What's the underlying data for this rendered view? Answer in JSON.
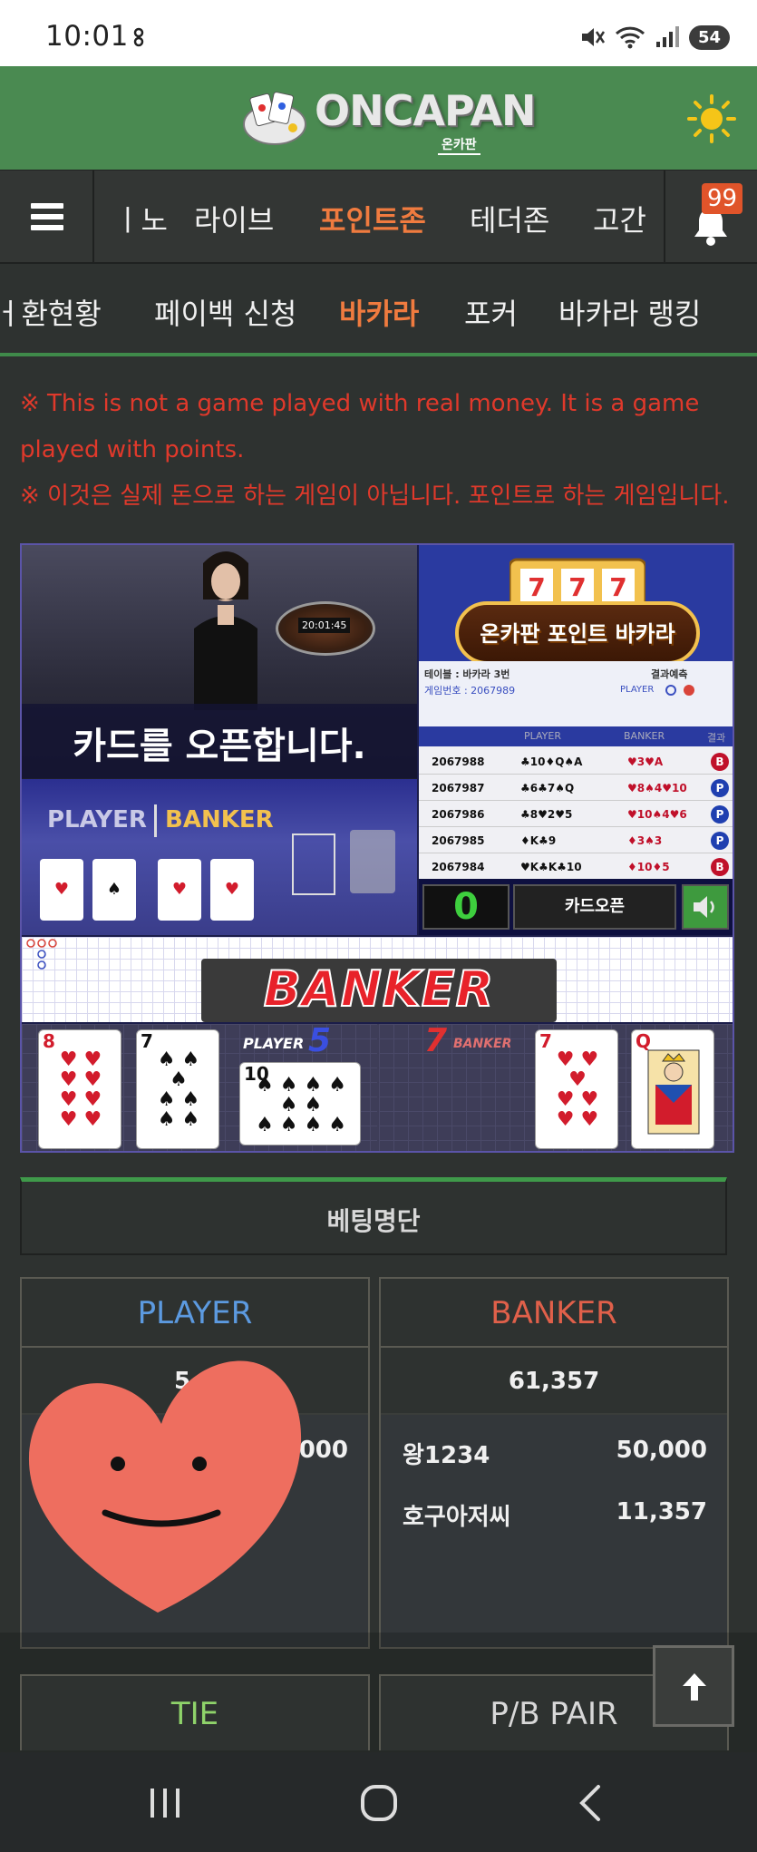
{
  "status_bar": {
    "time": "10:01",
    "battery": "54"
  },
  "header": {
    "logo_text": "ONCAPAN",
    "logo_sub": "온카판",
    "theme_icon": "sun-icon"
  },
  "main_nav": {
    "items": [
      "ㅣ노",
      "라이브",
      "포인트존",
      "테더존",
      "고간"
    ],
    "active": "포인트존",
    "notification_count": "99"
  },
  "sub_nav": {
    "items": [
      "ㅓ환현황",
      "페이백 신청",
      "바카라",
      "포커",
      "바카라 랭킹"
    ],
    "active": "바카라"
  },
  "notice": {
    "en": "※ This is not a game played with real money. It is a game played with points.",
    "ko": "※ 이것은 실제 돈으로 하는 게임이 아닙니다. 포인트로 하는 게임입니다."
  },
  "game": {
    "timer": "20:01:45",
    "banner_title": "온카판 포인트 바카라",
    "table_label": "테이블 : 바카라 3번",
    "game_no": "게임번호 : 2067989",
    "prediction_label": "결과예측",
    "player_short": "PLAYER",
    "banner_open_text": "카드를 오픈합니다.",
    "table_player_label": "PLAYER",
    "table_banker_label": "BANKER",
    "history_headers": [
      "PLAYER",
      "BANKER",
      "결과"
    ],
    "history": [
      {
        "id": "2067988",
        "player": "♣10♦Q♠A",
        "banker": "♥3♥A",
        "result": "B"
      },
      {
        "id": "2067987",
        "player": "♣6♣7♠Q",
        "banker": "♥8♠4♥10",
        "result": "P"
      },
      {
        "id": "2067986",
        "player": "♣8♥2♥5",
        "banker": "♥10♠4♥6",
        "result": "P"
      },
      {
        "id": "2067985",
        "player": "♦K♣9",
        "banker": "♦3♠3",
        "result": "P"
      },
      {
        "id": "2067984",
        "player": "♥K♣K♣10",
        "banker": "♦10♦5",
        "result": "B"
      }
    ],
    "countdown": "0",
    "card_open_button": "카드오픈",
    "result_text": "BANKER WIN",
    "player_score_label": "PLAYER",
    "player_score": "5",
    "banker_score_label": "BANKER",
    "banker_score": "7",
    "player_cards": [
      {
        "rank": "8",
        "suit": "♥",
        "color": "red"
      },
      {
        "rank": "7",
        "suit": "♠",
        "color": "black"
      },
      {
        "rank": "10",
        "suit": "♠",
        "color": "black"
      }
    ],
    "banker_cards": [
      {
        "rank": "7",
        "suit": "♥",
        "color": "red"
      },
      {
        "rank": "Q",
        "suit": "♥",
        "color": "red"
      }
    ]
  },
  "bet_list": {
    "title": "베팅명단",
    "player": {
      "title": "PLAYER",
      "total": "5,0",
      "entries": [
        {
          "name": "",
          "amount": ",000"
        }
      ]
    },
    "banker": {
      "title": "BANKER",
      "total": "61,357",
      "entries": [
        {
          "name": "왕1234",
          "amount": "50,000"
        },
        {
          "name": "호구아저씨",
          "amount": "11,357"
        }
      ]
    },
    "tie": {
      "title": "TIE"
    },
    "pair": {
      "title": "P/B PAIR"
    }
  },
  "colors": {
    "header_green": "#4a8a51",
    "active_orange": "#f07b3f",
    "notice_red": "#e0392b",
    "player_blue": "#5c9ae0",
    "banker_red": "#e0604a",
    "tie_green": "#8fd36a"
  }
}
